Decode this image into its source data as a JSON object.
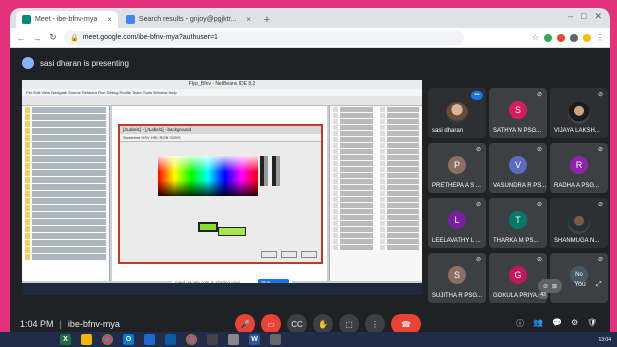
{
  "browser": {
    "tabs": [
      {
        "label": "Meet - ibe-bfnv-mya",
        "active": true,
        "icon": "meet-icon"
      },
      {
        "label": "Search results - gnjoy@pgjktr...",
        "active": false,
        "icon": "search-tab-icon"
      }
    ],
    "new_tab": "+",
    "url": "meet.google.com/ibe-bfnv-mya?authuser=1"
  },
  "presenting": {
    "text": "sasi dharan is presenting"
  },
  "shared_screen": {
    "ide_title": "Flyp_Bfnv - NetBeans IDE 8.2",
    "ide_menu": "File  Edit  View  Navigate  Source  Refactor  Run  Debug  Profile  Team  Tools  Window  Help",
    "dialog_title": "[JLabel1] - [JLabel1] - background",
    "dialog_tabs": "Swatches   HSV   HSL   RGB   CMYK",
    "share_bar_text": "meet.google.com is sharing your screen.",
    "stop_sharing": "Stop sharing",
    "colors": {
      "spectrum_accent": "#8be02e",
      "dialog_border": "#c0392b"
    }
  },
  "participants": [
    {
      "name": "sasi dharan",
      "initial": "",
      "color": "",
      "photo": true,
      "speaking": true
    },
    {
      "name": "SATHYA N PSG...",
      "initial": "S",
      "color": "#d81b60",
      "photo": false
    },
    {
      "name": "VIJAYA LAKSH...",
      "initial": "",
      "color": "",
      "photo": true
    },
    {
      "name": "PRETHEPA A S ...",
      "initial": "P",
      "color": "#8d6e63",
      "photo": false
    },
    {
      "name": "VASUNDRA R PS...",
      "initial": "V",
      "color": "#5c6bc0",
      "photo": false
    },
    {
      "name": "RADHA A PSG...",
      "initial": "R",
      "color": "#8e24aa",
      "photo": false
    },
    {
      "name": "LEELAVATHY L ...",
      "initial": "L",
      "color": "#7b1fa2",
      "photo": false
    },
    {
      "name": "THARKA M PS...",
      "initial": "T",
      "color": "#00796b",
      "photo": false
    },
    {
      "name": "SHANMUGA N...",
      "initial": "",
      "color": "",
      "photo": true
    },
    {
      "name": "SUJITHA R PSG...",
      "initial": "S",
      "color": "#8d6e63",
      "photo": false
    },
    {
      "name": "GOKULA PRIYA...",
      "initial": "G",
      "color": "#c2185b",
      "photo": false
    },
    {
      "name": "",
      "initial": "No",
      "color": "#455a64",
      "photo": false
    }
  ],
  "self_view": {
    "label": "You"
  },
  "participant_badge": "43",
  "callbar": {
    "time": "1:04 PM",
    "separator": "|",
    "meeting_code": "ibe-bfnv-mya"
  },
  "taskbar": {
    "clock": "13:04"
  }
}
